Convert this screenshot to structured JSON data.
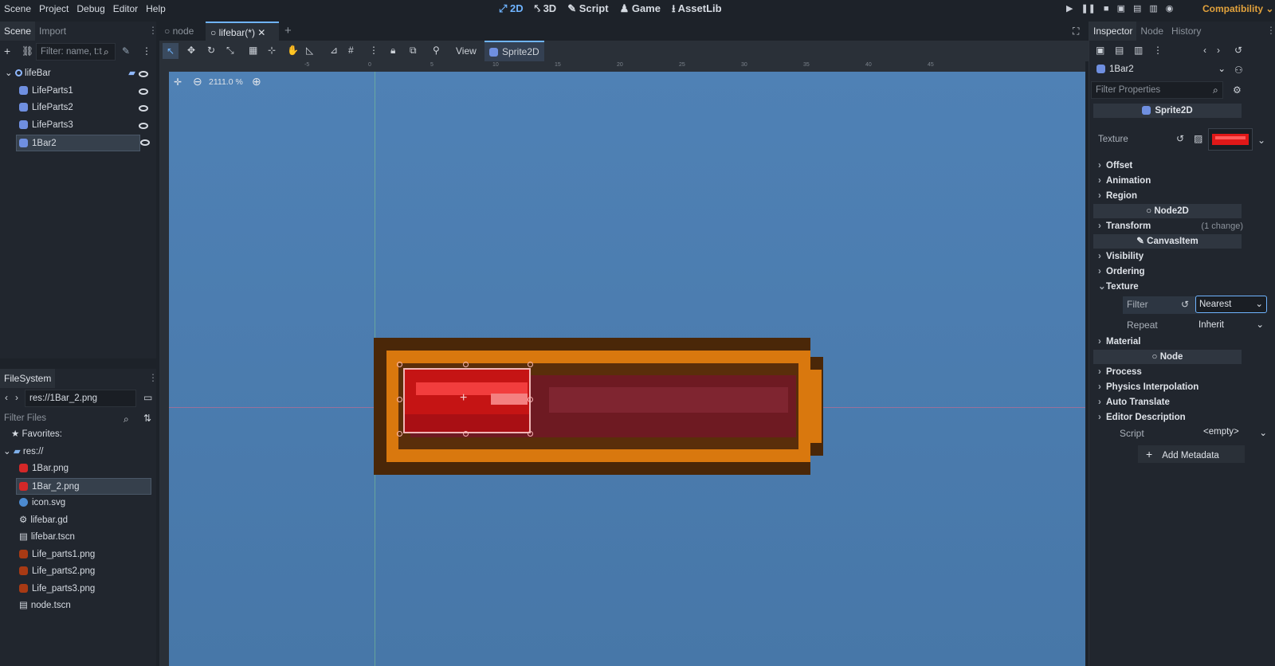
{
  "menu": [
    "Scene",
    "Project",
    "Debug",
    "Editor",
    "Help"
  ],
  "modes": {
    "m2d": "2D",
    "m3d": "3D",
    "script": "Script",
    "game": "Game",
    "assetlib": "AssetLib"
  },
  "renderer": "Compatibility",
  "scene_panel": {
    "tab_scene": "Scene",
    "tab_import": "Import",
    "filter_placeholder": "Filter: name, t:t",
    "nodes": [
      {
        "label": "lifeBar"
      },
      {
        "label": "LifeParts1"
      },
      {
        "label": "LifeParts2"
      },
      {
        "label": "LifeParts3"
      },
      {
        "label": "1Bar2"
      }
    ]
  },
  "filesystem": {
    "title": "FileSystem",
    "path": "res://1Bar_2.png",
    "filter_placeholder": "Filter Files",
    "favorites": "Favorites:",
    "root": "res://",
    "files": [
      "1Bar.png",
      "1Bar_2.png",
      "icon.svg",
      "lifebar.gd",
      "lifebar.tscn",
      "Life_parts1.png",
      "Life_parts2.png",
      "Life_parts3.png",
      "node.tscn"
    ]
  },
  "editor_tabs": {
    "tab1": "node",
    "tab2": "lifebar(*)"
  },
  "toolbar": {
    "view": "View",
    "sprite": "Sprite2D"
  },
  "zoom": "2111.0 %",
  "ruler_ticks": [
    "-5",
    "0",
    "5",
    "10",
    "15",
    "20",
    "25",
    "30",
    "35",
    "40",
    "45"
  ],
  "inspector": {
    "tab_inspector": "Inspector",
    "tab_node": "Node",
    "tab_history": "History",
    "node_name": "1Bar2",
    "filter_placeholder": "Filter Properties",
    "sprite2d": "Sprite2D",
    "texture_label": "Texture",
    "offset": "Offset",
    "animation": "Animation",
    "region": "Region",
    "node2d": "Node2D",
    "transform": "Transform",
    "transform_changes": "(1 change)",
    "canvasitem": "CanvasItem",
    "visibility": "Visibility",
    "ordering": "Ordering",
    "texture_section": "Texture",
    "filter_label": "Filter",
    "filter_value": "Nearest",
    "repeat_label": "Repeat",
    "repeat_value": "Inherit",
    "material": "Material",
    "node": "Node",
    "process": "Process",
    "physics": "Physics Interpolation",
    "auto_translate": "Auto Translate",
    "editor_desc": "Editor Description",
    "script_label": "Script",
    "script_value": "<empty>",
    "add_metadata": "Add Metadata"
  },
  "colors": {
    "accent": "#6fb4ff",
    "compat": "#e2a23c",
    "frame_dark": "#4a2708",
    "frame_orange": "#d9780e",
    "bar_red": "#d41a1a",
    "bar_dim": "#6e1a22"
  }
}
